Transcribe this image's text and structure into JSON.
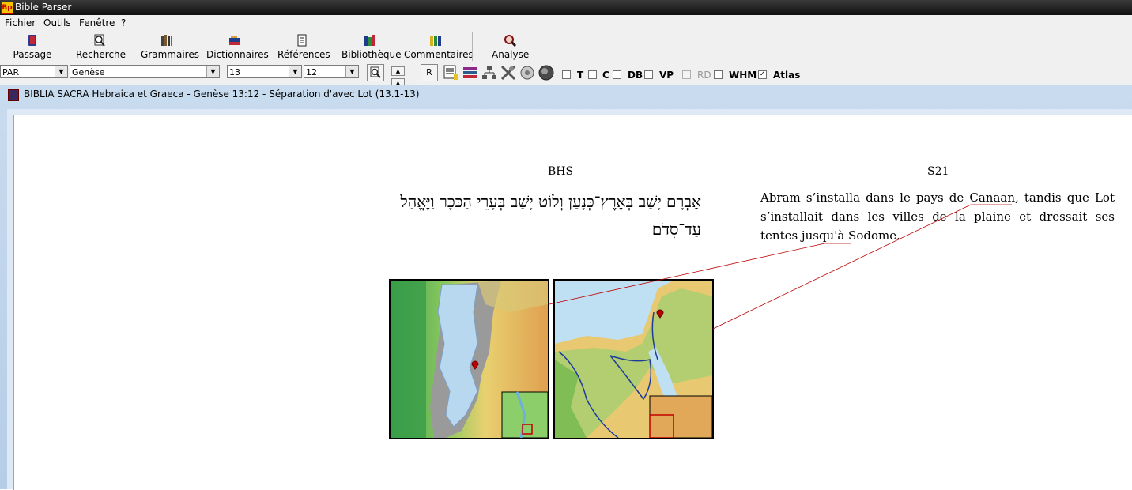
{
  "window": {
    "title": "Bible Parser",
    "app_icon": "Bp"
  },
  "menu": [
    {
      "label": "Fichier"
    },
    {
      "label": "Outils"
    },
    {
      "label": "Fenêtre"
    },
    {
      "label": "?"
    }
  ],
  "toolbar": {
    "passage": "Passage",
    "recherche": "Recherche",
    "grammaires": "Grammaires",
    "dictionnaires": "Dictionnaires",
    "references": "Références",
    "bibliotheque": "Bibliothèque",
    "commentaires": "Commentaires",
    "analyse": "Analyse"
  },
  "nav": {
    "version": "PAR",
    "book": "Genèse",
    "chapter": "13",
    "verse": "12",
    "r_label": "R",
    "checkboxes": [
      {
        "label": "T",
        "checked": false,
        "disabled": false
      },
      {
        "label": "C",
        "checked": false,
        "disabled": false
      },
      {
        "label": "DB",
        "checked": false,
        "disabled": false
      },
      {
        "label": "VP",
        "checked": false,
        "disabled": false
      },
      {
        "label": "RD",
        "checked": false,
        "disabled": true
      },
      {
        "label": "WHM",
        "checked": false,
        "disabled": false
      },
      {
        "label": "Atlas",
        "checked": true,
        "disabled": false
      }
    ]
  },
  "document": {
    "title": "BIBLIA SACRA Hebraica et Graeca - Genèse 13:12 - Séparation d'avec Lot (13.1-13)",
    "hebrew_heading": "BHS",
    "hebrew_text": "אַבְרָם יָשַׁב בְּאֶרֶץ־כְּנָעַן וְלוֹט יָשַׁב בְּעָרֵי הַכִּכָּר וַיֶּאֱהַל עַד־סְדֹם׃",
    "french_heading": "S21",
    "french": {
      "part1": "Abram s’installa dans le pays de ",
      "canaan": "Canaan",
      "part2": ", tandis que Lot s’installait dans les villes de la plaine et dressait ses tentes jusqu'à ",
      "sodome": "Sodome",
      "part3": "."
    }
  },
  "colors": {
    "accent_line": "#c00000",
    "titlebar": "#1a1a1a",
    "mdi_bg": "#bcd2ea"
  }
}
